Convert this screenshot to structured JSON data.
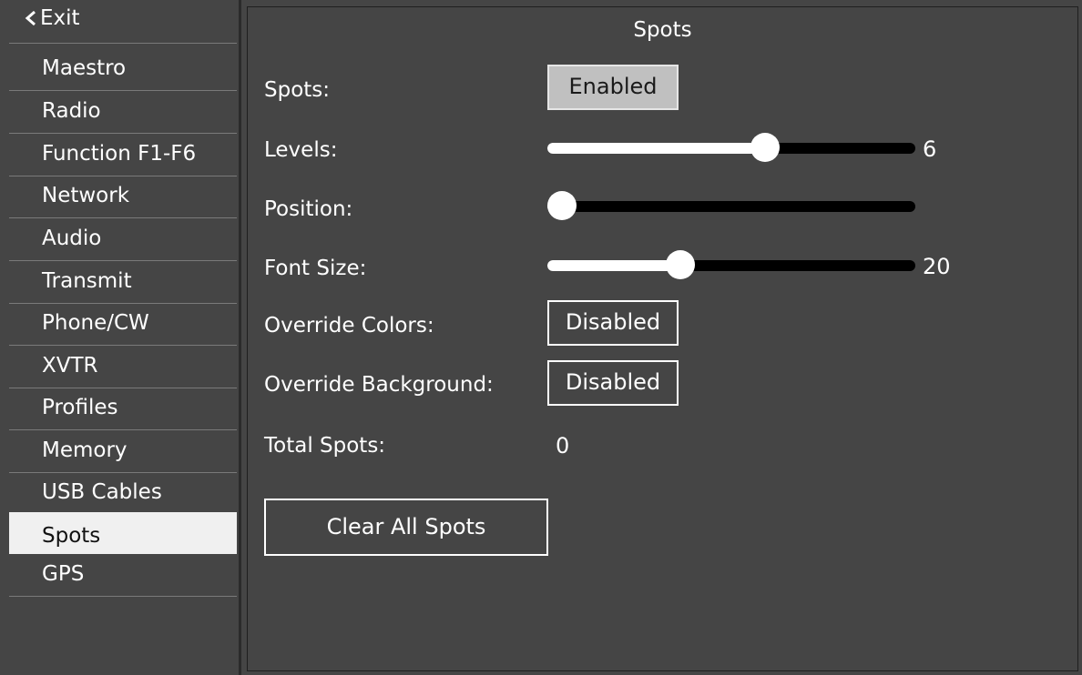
{
  "sidebar": {
    "exit_label": "Exit",
    "items": [
      {
        "label": "Maestro"
      },
      {
        "label": "Radio"
      },
      {
        "label": "Function F1-F6"
      },
      {
        "label": "Network"
      },
      {
        "label": "Audio"
      },
      {
        "label": "Transmit"
      },
      {
        "label": "Phone/CW"
      },
      {
        "label": "XVTR"
      },
      {
        "label": "Profiles"
      },
      {
        "label": "Memory"
      },
      {
        "label": "USB Cables"
      },
      {
        "label": "Spots",
        "selected": true
      },
      {
        "label": "GPS"
      }
    ]
  },
  "main": {
    "title": "Spots",
    "spots_label": "Spots:",
    "spots_value": "Enabled",
    "levels_label": "Levels:",
    "levels_value": "6",
    "levels_fraction": 0.6,
    "position_label": "Position:",
    "position_fraction": 0.0,
    "font_size_label": "Font Size:",
    "font_size_value": "20",
    "font_size_fraction": 0.35,
    "override_colors_label": "Override Colors:",
    "override_colors_value": "Disabled",
    "override_background_label": "Override Background:",
    "override_background_value": "Disabled",
    "total_spots_label": "Total Spots:",
    "total_spots_value": "0",
    "clear_button": "Clear All Spots"
  },
  "colors": {
    "background": "#454545",
    "selected_item_bg": "#f0f0f0",
    "enabled_button_bg": "#c0c0c0"
  }
}
